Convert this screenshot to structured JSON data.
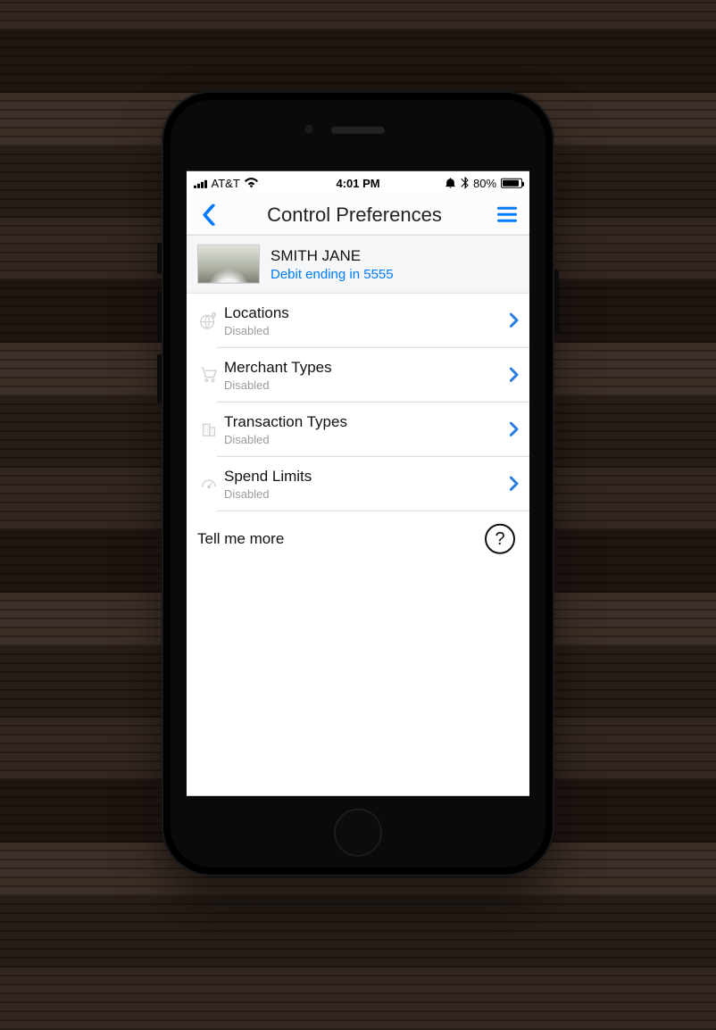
{
  "status": {
    "carrier": "AT&T",
    "time": "4:01 PM",
    "battery_pct": "80%"
  },
  "nav": {
    "title": "Control Preferences"
  },
  "card": {
    "name": "SMITH JANE",
    "subtitle": "Debit ending in 5555"
  },
  "rows": [
    {
      "title": "Locations",
      "status": "Disabled"
    },
    {
      "title": "Merchant Types",
      "status": "Disabled"
    },
    {
      "title": "Transaction Types",
      "status": "Disabled"
    },
    {
      "title": "Spend Limits",
      "status": "Disabled"
    }
  ],
  "tell_me_more": "Tell me more",
  "help_glyph": "?"
}
